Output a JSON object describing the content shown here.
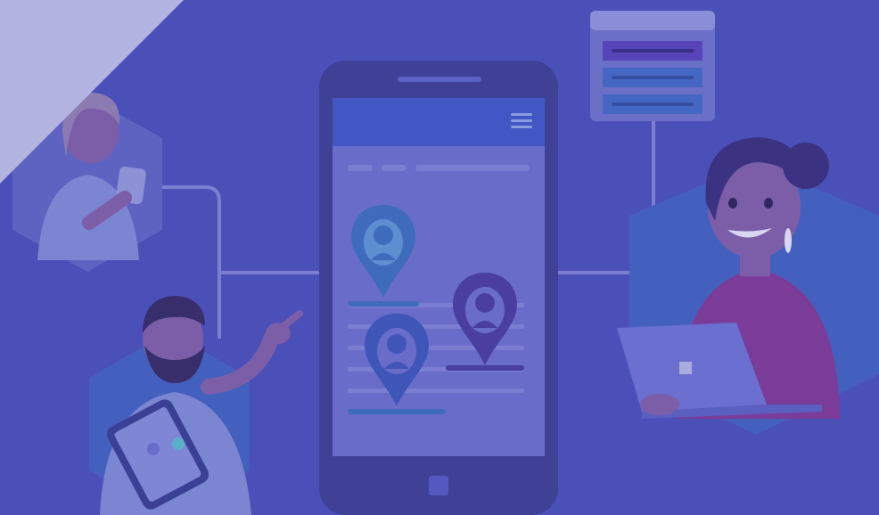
{
  "colors": {
    "background": "#4b4fb8",
    "corner_ribbon": "#b3b4e0",
    "phone_body": "#3e4196",
    "phone_screen": "#6a6cc9",
    "phone_header": "#4357c4",
    "connector": "#7b7fd0",
    "pin_blue": "#3f6bbd",
    "pin_purple": "#4a3ea0",
    "hexagon_blue": "#4460be",
    "hexagon_pale": "#6a70c8",
    "card_frame": "#6b6fc8",
    "card_bar_purple": "#5644b8",
    "card_bar_blue": "#4567c4",
    "person_skin": "#7c5ea8",
    "woman_shirt": "#7a3c98",
    "laptop": "#6a6fd0"
  },
  "icons": {
    "menu": "hamburger-menu-icon",
    "home": "home-button-icon",
    "pins": [
      "person-location-pin-icon",
      "person-location-pin-icon",
      "person-location-pin-icon"
    ]
  }
}
